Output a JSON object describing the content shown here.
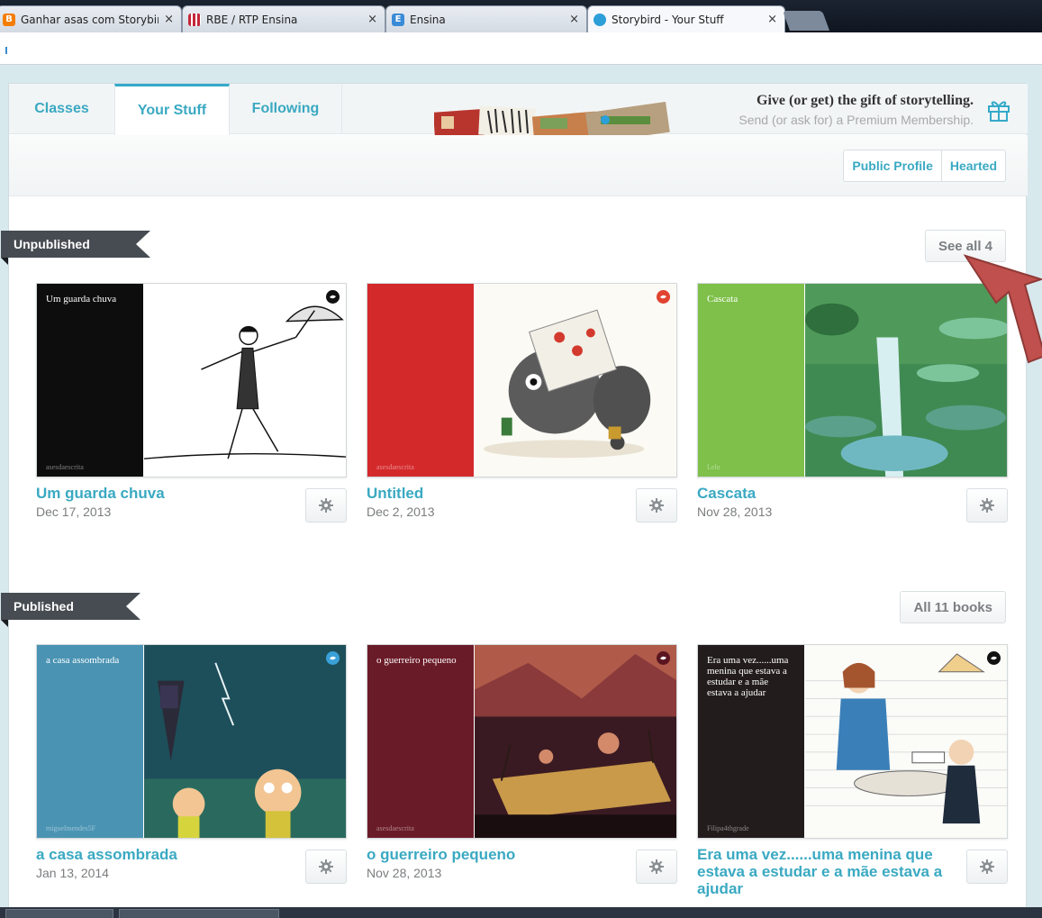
{
  "browser": {
    "tabs": [
      {
        "title": "Ganhar asas com Storybir",
        "icon": "blogger-icon",
        "color": "#f57d00"
      },
      {
        "title": "RBE / RTP Ensina",
        "icon": "rbe-icon",
        "color": "#c4263a"
      },
      {
        "title": "Ensina",
        "icon": "ensina-icon",
        "color": "#3a8bd6"
      },
      {
        "title": "Storybird - Your Stuff",
        "icon": "storybird-icon",
        "color": "#2c9fd9"
      }
    ],
    "close_glyph": "×"
  },
  "nav": {
    "tabs": [
      "Classes",
      "Your Stuff",
      "Following"
    ],
    "active": "Your Stuff",
    "promo": {
      "title": "Give (or get) the gift of storytelling.",
      "subtitle": "Send (or ask for) a Premium Membership."
    }
  },
  "subbar": {
    "public_profile": "Public Profile",
    "hearted": "Hearted"
  },
  "unpublished": {
    "label": "Unpublished",
    "see_all": "See all 4",
    "books": [
      {
        "title": "Um guarda chuva",
        "date": "Dec 17, 2013",
        "spine_text": "Um guarda chuva",
        "author": "asesdaescrita",
        "spine_color": "#0d0d0d",
        "badge": "#111111"
      },
      {
        "title": "Untitled",
        "date": "Dec 2, 2013",
        "spine_text": "",
        "author": "asesdaescrita",
        "spine_color": "#d4292b",
        "badge": "#e0432f"
      },
      {
        "title": "Cascata",
        "date": "Nov 28, 2013",
        "spine_text": "Cascata",
        "author": "Lelo",
        "spine_color": "#7ec04a",
        "badge": ""
      }
    ]
  },
  "published": {
    "label": "Published",
    "see_all": "All 11 books",
    "books": [
      {
        "title": "a casa assombrada",
        "date": "Jan 13, 2014",
        "spine_text": "a casa assombrada",
        "author": "miguelmendes5F",
        "spine_color": "#4a93b3",
        "badge": "#3aa0d8"
      },
      {
        "title": "o guerreiro pequeno",
        "date": "Nov 28, 2013",
        "spine_text": "o guerreiro pequeno",
        "author": "asesdaescrita",
        "spine_color": "#6a1b28",
        "badge": "#5a1520"
      },
      {
        "title": "Era uma vez......uma menina que estava a estudar e a mãe estava a ajudar",
        "date": "",
        "spine_text": "Era uma vez......uma menina que estava a estudar e a mãe estava a ajudar",
        "author": "Filipa4thgrade",
        "spine_color": "#231c1d",
        "badge": "#111111"
      }
    ]
  },
  "colors": {
    "accent": "#3aa9c2",
    "ribbon": "#474c52",
    "arrow": "#c0504d"
  }
}
